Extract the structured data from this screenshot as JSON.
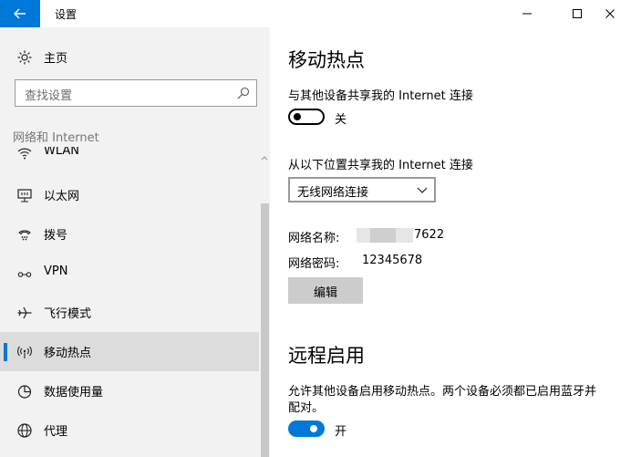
{
  "titlebar": {
    "title": "设置",
    "back_icon": "back-arrow-icon",
    "minimize_icon": "minimize-icon",
    "maximize_icon": "maximize-icon",
    "close_icon": "close-icon"
  },
  "sidebar": {
    "home_label": "主页",
    "home_icon": "gear-icon",
    "search_placeholder": "查找设置",
    "section_header": "网络和 Internet",
    "items": [
      {
        "label": "WLAN",
        "icon": "wifi-icon"
      },
      {
        "label": "以太网",
        "icon": "ethernet-icon"
      },
      {
        "label": "拨号",
        "icon": "dialup-icon"
      },
      {
        "label": "VPN",
        "icon": "vpn-icon"
      },
      {
        "label": "飞行模式",
        "icon": "airplane-icon"
      },
      {
        "label": "移动热点",
        "icon": "hotspot-icon",
        "active": true
      },
      {
        "label": "数据使用量",
        "icon": "data-usage-icon"
      },
      {
        "label": "代理",
        "icon": "globe-icon"
      }
    ]
  },
  "main": {
    "hotspot_title": "移动热点",
    "share_label": "与其他设备共享我的 Internet 连接",
    "share_toggle_state": "关",
    "share_toggle_on": false,
    "share_from_label": "从以下位置共享我的 Internet 连接",
    "share_from_value": "无线网络连接",
    "network_name_label": "网络名称:",
    "network_name_value": "7622",
    "network_password_label": "网络密码:",
    "network_password_value": "12345678",
    "edit_button": "编辑",
    "remote_title": "远程启用",
    "remote_desc_line1": "允许其他设备启用移动热点。两个设备必须都已启用蓝牙并",
    "remote_desc_line2": "配对。",
    "remote_toggle_state": "开",
    "remote_toggle_on": true
  },
  "colors": {
    "accent": "#0078d7",
    "sidebar_bg": "#f2f2f2",
    "active_item_bg": "#dcdcdc"
  }
}
